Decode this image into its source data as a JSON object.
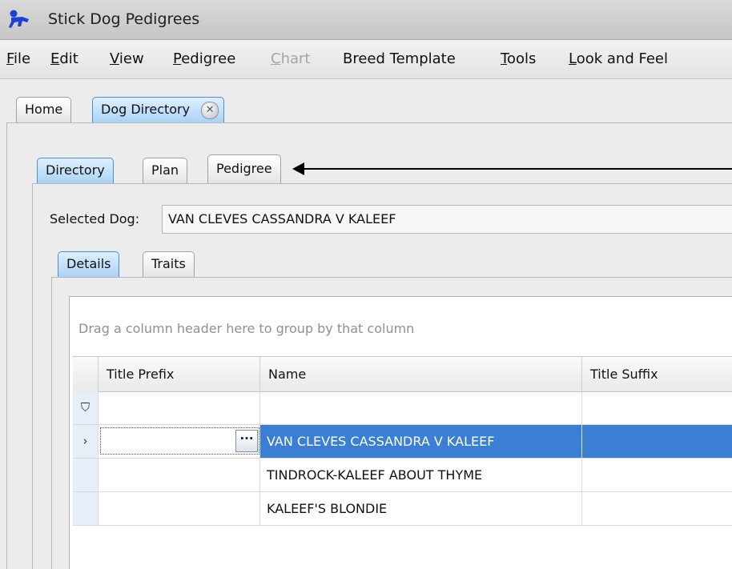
{
  "window": {
    "title": "Stick Dog Pedigrees",
    "icon": "blue-dog-icon"
  },
  "menu": [
    {
      "label": "File",
      "underline": "F",
      "rest": "ile",
      "disabled": false
    },
    {
      "label": "Edit",
      "underline": "E",
      "rest": "dit",
      "disabled": false
    },
    {
      "label": "View",
      "underline": "V",
      "rest": "iew",
      "disabled": false
    },
    {
      "label": "Pedigree",
      "underline": "P",
      "rest": "edigree",
      "disabled": false
    },
    {
      "label": "Chart",
      "underline": "C",
      "rest": "hart",
      "disabled": true
    },
    {
      "label": "Breed Template",
      "disabled": false
    },
    {
      "label": "Tools",
      "underline": "T",
      "rest": "ools",
      "disabled": false
    },
    {
      "label": "Look and Feel",
      "underline": "L",
      "rest": "ook and Feel",
      "disabled": false
    }
  ],
  "doc_tabs": {
    "home": "Home",
    "dog_directory": "Dog Directory",
    "close_glyph": "✕"
  },
  "section_tabs": {
    "directory": "Directory",
    "plan": "Plan",
    "pedigree": "Pedigree"
  },
  "selected_dog": {
    "label": "Selected Dog:",
    "value": "VAN CLEVES CASSANDRA V KALEEF"
  },
  "detail_tabs": {
    "details": "Details",
    "traits": "Traits"
  },
  "grid": {
    "group_hint": "Drag a column header here to group by that column",
    "columns": {
      "title_prefix": "Title Prefix",
      "name": "Name",
      "title_suffix": "Title Suffix"
    },
    "filter_icon": "⛉",
    "current_row_marker": "›",
    "ellipsis": "···",
    "rows": [
      {
        "title_prefix": "",
        "name": "VAN CLEVES CASSANDRA V KALEEF",
        "title_suffix": ""
      },
      {
        "title_prefix": "",
        "name": "TINDROCK-KALEEF ABOUT THYME",
        "title_suffix": ""
      },
      {
        "title_prefix": "",
        "name": "KALEEF'S BLONDIE",
        "title_suffix": ""
      }
    ]
  },
  "colors": {
    "accent": "#3a7fd4",
    "tab_active": "#a9d3f6"
  }
}
